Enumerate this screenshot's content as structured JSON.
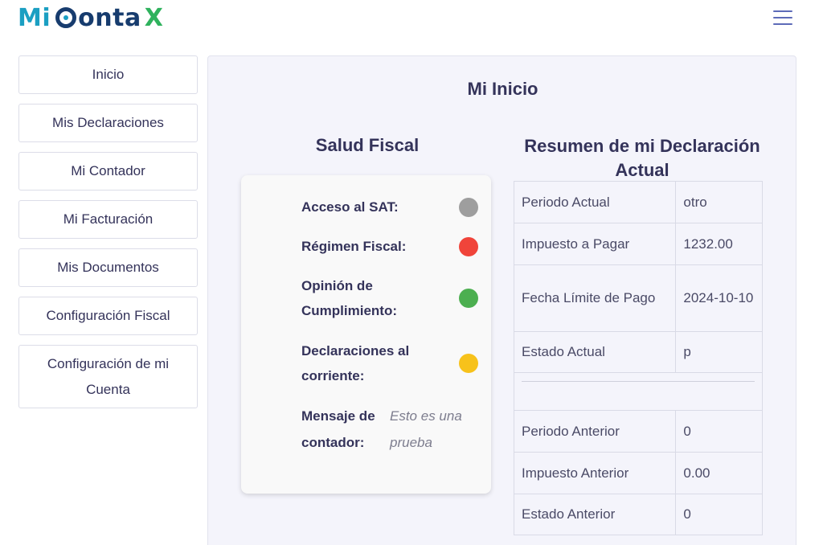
{
  "header": {
    "logo": {
      "part1": "Mi",
      "part2": "onta",
      "part3": "X"
    },
    "menu_icon": "hamburger-menu-icon"
  },
  "sidebar": {
    "items": [
      {
        "label": "Inicio"
      },
      {
        "label": "Mis Declaraciones"
      },
      {
        "label": "Mi Contador"
      },
      {
        "label": "Mi Facturación"
      },
      {
        "label": "Mis Documentos"
      },
      {
        "label": "Configuración Fiscal"
      },
      {
        "label": "Configuración de mi Cuenta"
      }
    ]
  },
  "main": {
    "title": "Mi Inicio",
    "salud": {
      "title": "Salud Fiscal",
      "items": [
        {
          "label": "Acceso al SAT:",
          "status_color": "#9e9e9e"
        },
        {
          "label": "Régimen Fiscal:",
          "status_color": "#f0443a"
        },
        {
          "label": "Opinión de Cumplimiento:",
          "status_color": "#4caf50"
        },
        {
          "label": "Declaraciones al corriente:",
          "status_color": "#f7c21b"
        }
      ],
      "message": {
        "label": "Mensaje de contador:",
        "value": "Esto es una prueba"
      }
    },
    "resumen": {
      "title": "Resumen de mi Declaración Actual",
      "current": [
        {
          "key": "Periodo Actual",
          "value": "otro"
        },
        {
          "key": "Impuesto a Pagar",
          "value": "1232.00"
        },
        {
          "key": "Fecha Límite de Pago",
          "value": "2024-10-10"
        },
        {
          "key": "Estado Actual",
          "value": "p"
        }
      ],
      "previous": [
        {
          "key": "Periodo Anterior",
          "value": "0"
        },
        {
          "key": "Impuesto Anterior",
          "value": "0.00"
        },
        {
          "key": "Estado Anterior",
          "value": "0"
        }
      ]
    }
  }
}
